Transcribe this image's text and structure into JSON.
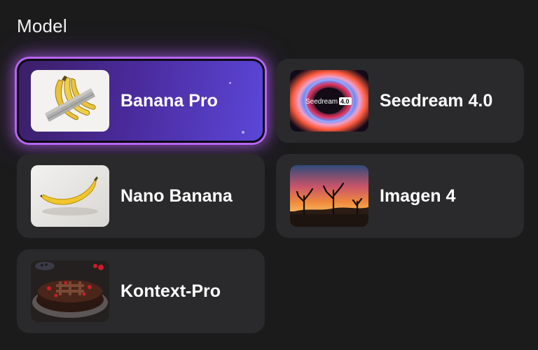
{
  "section": {
    "title": "Model"
  },
  "models": [
    {
      "id": "banana-pro",
      "label": "Banana Pro",
      "selected": true,
      "thumbnail": "taped-bananas"
    },
    {
      "id": "seedream",
      "label": "Seedream 4.0",
      "selected": false,
      "thumbnail": "seedream-swirl",
      "thumb_text": "Seedream",
      "thumb_badge": "4.0"
    },
    {
      "id": "nano-banana",
      "label": "Nano Banana",
      "selected": false,
      "thumbnail": "single-banana"
    },
    {
      "id": "imagen",
      "label": "Imagen 4",
      "selected": false,
      "thumbnail": "desert-sunset"
    },
    {
      "id": "kontext-pro",
      "label": "Kontext-Pro",
      "selected": false,
      "thumbnail": "chocolate-cake"
    }
  ],
  "colors": {
    "background": "#1b1b1b",
    "card": "#2a2a2c",
    "selected_glow": "#b764f2",
    "selected_gradient_start": "#3b1f67",
    "selected_gradient_end": "#5b46d8"
  }
}
